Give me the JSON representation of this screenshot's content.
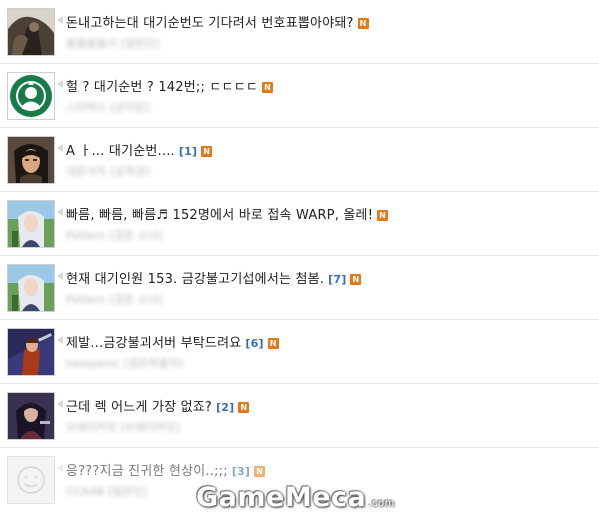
{
  "posts": [
    {
      "title": "돈내고하는대 대기순번도 기다려서 번호표뽑아야돼?",
      "count": "",
      "author": "봄봄봄봄서",
      "level": "[일반인]",
      "avatar_icon": "dark-warrior-avatar",
      "new_badge": "N"
    },
    {
      "title": "헐 ? 대기순번 ? 142번;; ㄷㄷㄷㄷ",
      "count": "",
      "author": "스타벅스",
      "level": "[군이된]",
      "avatar_icon": "starbucks-logo-avatar",
      "new_badge": "N"
    },
    {
      "title": "A ㅏ... 대기순번....",
      "count": "[1]",
      "author": "네온서지",
      "level": "[상위권]",
      "avatar_icon": "dark-hair-character-avatar",
      "new_badge": "N"
    },
    {
      "title": "빠름, 빠름, 빠름♬ 152명에서 바로 접속 WARP, 올레!",
      "count": "",
      "author": "Pattern",
      "level": "[검은 소녀]",
      "avatar_icon": "white-hair-character-avatar",
      "new_badge": "N"
    },
    {
      "title": "현재 대기인원 153. 금강불고기섭에서는 첨봄.",
      "count": "[7]",
      "author": "Pattern",
      "level": "[검은 소녀]",
      "avatar_icon": "white-hair-character-avatar",
      "new_badge": "N"
    },
    {
      "title": "제발...금강불괴서버 부탁드려요",
      "count": "[6]",
      "author": "bestpanic",
      "level": "[검은착용자]",
      "avatar_icon": "warrior-pose-avatar",
      "new_badge": "N"
    },
    {
      "title": "근데 렉 어느게 가장 없죠?",
      "count": "[2]",
      "author": "브레이커잇",
      "level": "[브레이커잇]",
      "avatar_icon": "dark-fighter-avatar",
      "new_badge": "N"
    },
    {
      "title": "응???지금 진귀한 현상이..;;;",
      "count": "[3]",
      "author": "CCAAB",
      "level": "[일반인]",
      "avatar_icon": "default-smiley-avatar",
      "new_badge": "N"
    }
  ],
  "watermark": {
    "brand": "GameMeca",
    "suffix": ".com"
  },
  "colors": {
    "title": "#222222",
    "count": "#3a6ea8",
    "new_badge": "#e07b1c",
    "meta": "#b8b8b8",
    "divider": "#e8e8e8"
  }
}
